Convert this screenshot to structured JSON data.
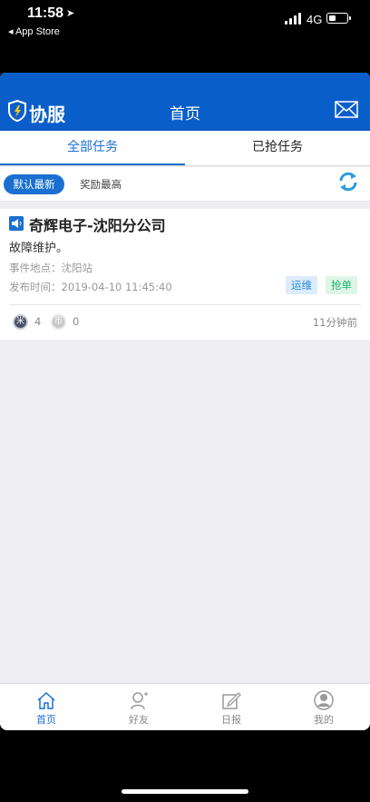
{
  "status_bar": {
    "time": "11:58",
    "back_app": "◂ App Store",
    "network": "4G"
  },
  "header": {
    "logo_text": "协服",
    "title": "首页"
  },
  "tabs": [
    {
      "label": "全部任务"
    },
    {
      "label": "已抢任务"
    }
  ],
  "sort": {
    "default_label": "默认最新",
    "reward_label": "奖励最高"
  },
  "task": {
    "title": "奇辉电子-沈阳分公司",
    "description": "故障维护。",
    "location": "事件地点：沈阳站",
    "published": "发布时间：2019-04-10 11:45:40",
    "tags": [
      "运维",
      "抢单"
    ],
    "rice_icon": "米",
    "rice_count": "4",
    "coin_icon": "币",
    "coin_count": "0",
    "time_ago": "11分钟前"
  },
  "tabbar": [
    {
      "label": "首页",
      "icon": "home-icon"
    },
    {
      "label": "好友",
      "icon": "friends-icon"
    },
    {
      "label": "日报",
      "icon": "report-icon"
    },
    {
      "label": "我的",
      "icon": "profile-icon"
    }
  ],
  "colors": {
    "brand": "#0a5ec9",
    "accent": "#1a6fd1",
    "tag_ops": "#2b86d8",
    "tag_grab": "#1db36a"
  }
}
